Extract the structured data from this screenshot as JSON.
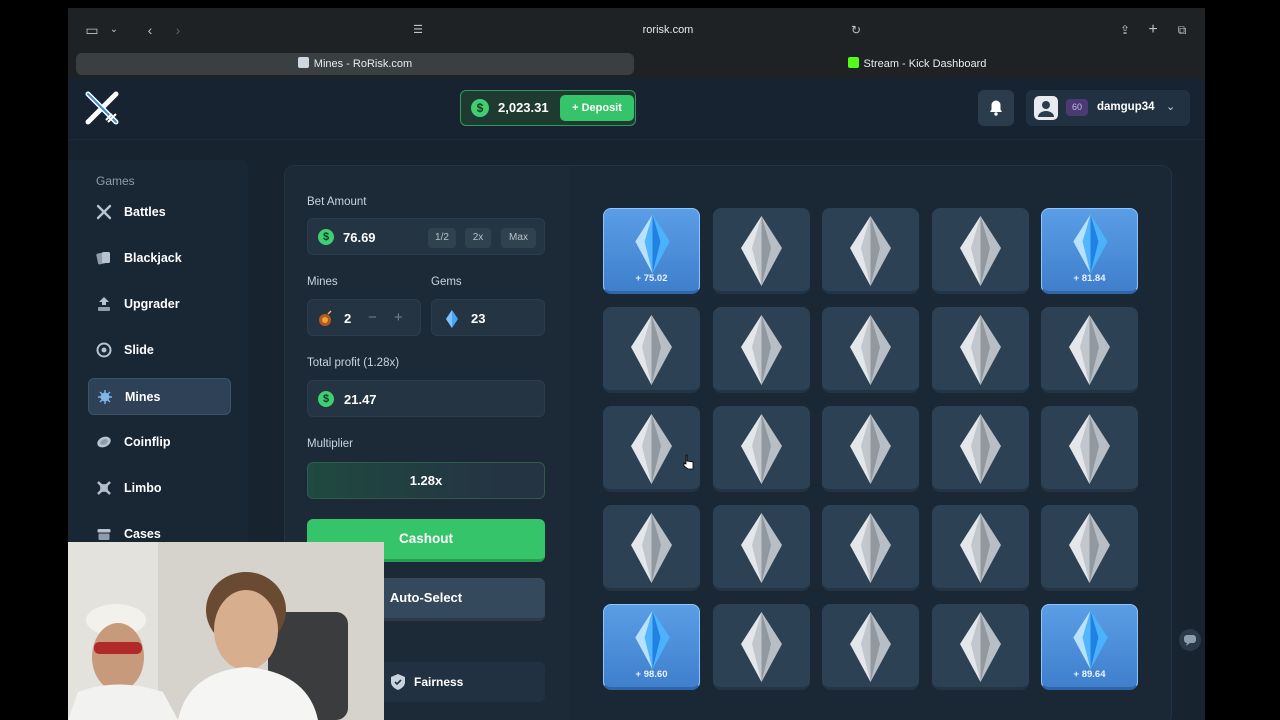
{
  "browser": {
    "url": "rorisk.com",
    "tabs": [
      {
        "label": "Mines - RoRisk.com"
      },
      {
        "label": "Stream - Kick Dashboard"
      }
    ]
  },
  "header": {
    "balance": "2,023.31",
    "deposit_label": "Deposit",
    "level": "60",
    "username": "damgup34"
  },
  "sidebar": {
    "title": "Games",
    "items": [
      {
        "label": "Battles"
      },
      {
        "label": "Blackjack"
      },
      {
        "label": "Upgrader"
      },
      {
        "label": "Slide"
      },
      {
        "label": "Mines"
      },
      {
        "label": "Coinflip"
      },
      {
        "label": "Limbo"
      },
      {
        "label": "Cases"
      }
    ],
    "active": "Mines"
  },
  "controls": {
    "bet_label": "Bet Amount",
    "bet_value": "76.69",
    "half": "1/2",
    "double": "2x",
    "max": "Max",
    "mines_label": "Mines",
    "mines_value": "2",
    "minus": "−",
    "plus": "+",
    "gems_label": "Gems",
    "gems_value": "23",
    "profit_label": "Total profit (1.28x)",
    "profit_value": "21.47",
    "multiplier_label": "Multiplier",
    "multiplier_value": "1.28x",
    "cashout": "Cashout",
    "autoselect": "Auto-Select",
    "fairness": "Fairness"
  },
  "grid": {
    "rows": 5,
    "cols": 5,
    "revealed": [
      {
        "index": 0,
        "value": "+ 75.02"
      },
      {
        "index": 4,
        "value": "+ 81.84"
      },
      {
        "index": 20,
        "value": "+ 98.60"
      },
      {
        "index": 24,
        "value": "+ 89.64"
      }
    ]
  },
  "colors": {
    "accent_green": "#35c46a",
    "gem_blue": "#4a8fdd",
    "background": "#17232f"
  }
}
